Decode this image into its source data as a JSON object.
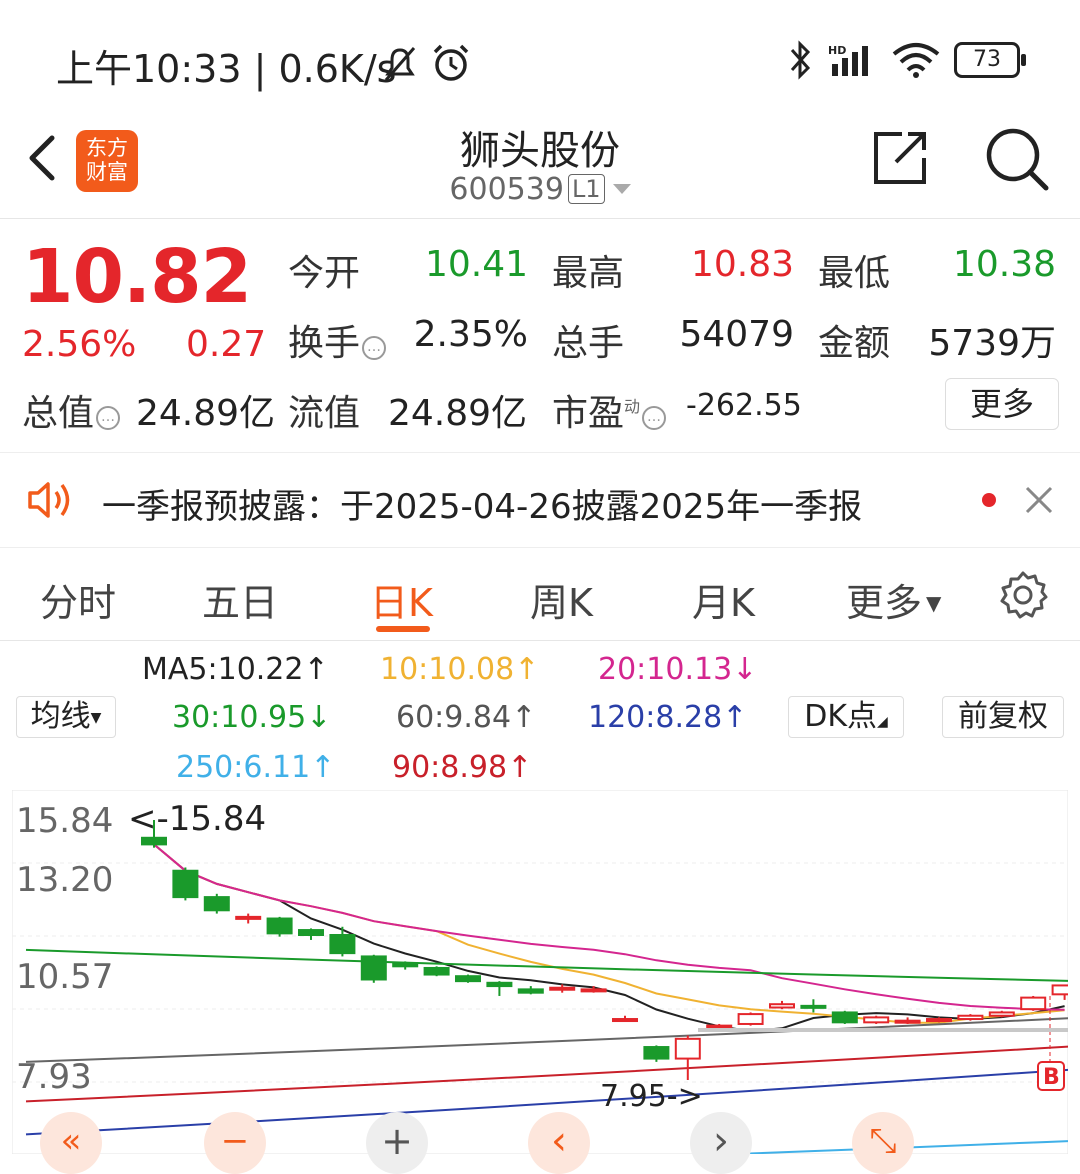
{
  "status_bar": {
    "time_text": "上午10:33 | 0.6K/s",
    "battery": "73"
  },
  "header": {
    "logo_text_1": "东方",
    "logo_text_2": "财富",
    "stock_name": "狮头股份",
    "stock_code": "600539",
    "level": "L1"
  },
  "quote": {
    "price": "10.82",
    "change_pct": "2.56%",
    "change_amt": "0.27",
    "open_label": "今开",
    "open": "10.41",
    "high_label": "最高",
    "high": "10.83",
    "low_label": "最低",
    "low": "10.38",
    "turnover_label": "换手",
    "turnover": "2.35%",
    "volume_label": "总手",
    "volume": "54079",
    "amount_label": "金额",
    "amount": "5739万",
    "mktcap_label": "总值",
    "mktcap": "24.89亿",
    "float_label": "流值",
    "float_cap": "24.89亿",
    "pe_label": "市盈",
    "pe_sup": "动",
    "pe": "-262.55",
    "more_label": "更多"
  },
  "notice": {
    "text": "一季报预披露：于2025-04-26披露2025年一季报"
  },
  "tabs": [
    "分时",
    "五日",
    "日K",
    "周K",
    "月K",
    "更多"
  ],
  "ma": {
    "selector": "均线",
    "ma5": "MA5:10.22↑",
    "ma10": "10:10.08↑",
    "ma20": "20:10.13↓",
    "ma30": "30:10.95↓",
    "ma60": "60:9.84↑",
    "ma120": "120:8.28↑",
    "ma250": "250:6.11↑",
    "ma90": "90:8.98↑",
    "dk_label": "DK点",
    "adjust_label": "前复权"
  },
  "chart_data": {
    "type": "candlestick",
    "y_ticks": [
      "15.84",
      "13.20",
      "10.57",
      "7.93"
    ],
    "high_annotation": "<-15.84",
    "low_annotation": "7.95->",
    "marker": "B",
    "colors": {
      "up": "#e4262b",
      "down": "#1a9a2b",
      "ma5": "#222222",
      "ma10": "#f0b232",
      "ma20": "#d4268f",
      "ma30": "#1a9a2b",
      "ma60": "#666666",
      "ma90": "#c8202a",
      "ma120": "#2a3fa8",
      "ma250": "#40b0e8"
    },
    "candles": [
      {
        "o": 15.3,
        "c": 15.1,
        "h": 15.84,
        "l": 15.0
      },
      {
        "o": 14.3,
        "c": 13.5,
        "h": 14.4,
        "l": 13.4
      },
      {
        "o": 13.5,
        "c": 13.1,
        "h": 13.6,
        "l": 13.0
      },
      {
        "o": 12.85,
        "c": 12.9,
        "h": 13.0,
        "l": 12.7
      },
      {
        "o": 12.85,
        "c": 12.4,
        "h": 12.9,
        "l": 12.3
      },
      {
        "o": 12.5,
        "c": 12.35,
        "h": 12.55,
        "l": 12.2
      },
      {
        "o": 12.35,
        "c": 11.8,
        "h": 12.6,
        "l": 11.7
      },
      {
        "o": 11.7,
        "c": 11.0,
        "h": 11.75,
        "l": 10.9
      },
      {
        "o": 11.5,
        "c": 11.4,
        "h": 11.55,
        "l": 11.3
      },
      {
        "o": 11.35,
        "c": 11.15,
        "h": 11.4,
        "l": 11.1
      },
      {
        "o": 11.1,
        "c": 10.95,
        "h": 11.15,
        "l": 10.9
      },
      {
        "o": 10.9,
        "c": 10.8,
        "h": 10.95,
        "l": 10.5
      },
      {
        "o": 10.7,
        "c": 10.6,
        "h": 10.8,
        "l": 10.55
      },
      {
        "o": 10.7,
        "c": 10.75,
        "h": 10.85,
        "l": 10.6
      },
      {
        "o": 10.65,
        "c": 10.7,
        "h": 10.8,
        "l": 10.6
      },
      {
        "o": 9.8,
        "c": 9.8,
        "h": 9.9,
        "l": 9.75
      },
      {
        "o": 8.95,
        "c": 8.6,
        "h": 9.0,
        "l": 8.5
      },
      {
        "o": 8.6,
        "c": 9.2,
        "h": 9.3,
        "l": 7.95
      },
      {
        "o": 9.55,
        "c": 9.6,
        "h": 9.65,
        "l": 9.5
      },
      {
        "o": 9.65,
        "c": 9.95,
        "h": 10.0,
        "l": 9.6
      },
      {
        "o": 10.15,
        "c": 10.25,
        "h": 10.35,
        "l": 10.1
      },
      {
        "o": 10.2,
        "c": 10.15,
        "h": 10.4,
        "l": 10.0
      },
      {
        "o": 10.0,
        "c": 9.7,
        "h": 10.05,
        "l": 9.65
      },
      {
        "o": 9.7,
        "c": 9.85,
        "h": 9.9,
        "l": 9.65
      },
      {
        "o": 9.75,
        "c": 9.75,
        "h": 9.85,
        "l": 9.65
      },
      {
        "o": 9.75,
        "c": 9.8,
        "h": 9.85,
        "l": 9.7
      },
      {
        "o": 9.8,
        "c": 9.9,
        "h": 9.95,
        "l": 9.75
      },
      {
        "o": 9.9,
        "c": 10.0,
        "h": 10.05,
        "l": 9.85
      },
      {
        "o": 10.1,
        "c": 10.45,
        "h": 10.5,
        "l": 10.05
      },
      {
        "o": 10.55,
        "c": 10.82,
        "h": 10.83,
        "l": 10.38
      }
    ]
  },
  "toolbar": {
    "rewind": "«",
    "minus": "−",
    "plus": "+",
    "prev": "‹",
    "next": "›",
    "expand": "⤡"
  }
}
